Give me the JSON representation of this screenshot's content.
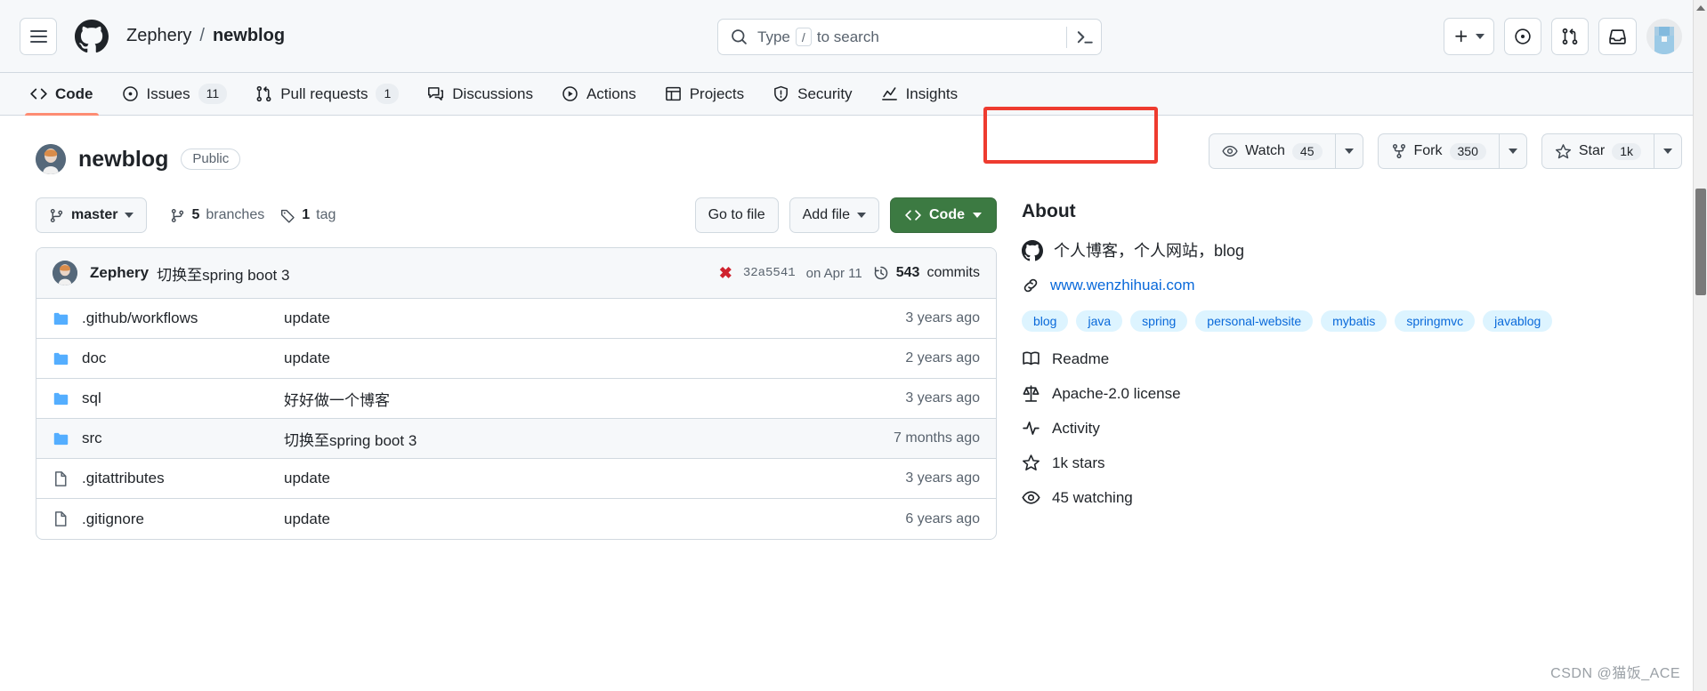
{
  "header": {
    "menu_label": "menu",
    "breadcrumb": {
      "owner": "Zephery",
      "separator": "/",
      "repo": "newblog"
    },
    "search": {
      "placeholder_prefix": "Type",
      "slash_key": "/",
      "placeholder_suffix": "to search"
    },
    "top_buttons": [
      "create-new",
      "issues-feed",
      "pull-requests",
      "inbox",
      "profile"
    ]
  },
  "nav": {
    "tabs": [
      {
        "label": "Code",
        "icon": "code-icon",
        "count": "",
        "active": true
      },
      {
        "label": "Issues",
        "icon": "issue-icon",
        "count": "11",
        "active": false
      },
      {
        "label": "Pull requests",
        "icon": "pull-request-icon",
        "count": "1",
        "active": false
      },
      {
        "label": "Discussions",
        "icon": "discussion-icon",
        "count": "",
        "active": false
      },
      {
        "label": "Actions",
        "icon": "play-icon",
        "count": "",
        "active": false
      },
      {
        "label": "Projects",
        "icon": "table-icon",
        "count": "",
        "active": false
      },
      {
        "label": "Security",
        "icon": "shield-icon",
        "count": "",
        "active": false
      },
      {
        "label": "Insights",
        "icon": "graph-icon",
        "count": "",
        "active": false
      }
    ]
  },
  "repo": {
    "name": "newblog",
    "visibility": "Public",
    "watch": {
      "label": "Watch",
      "count": "45"
    },
    "fork": {
      "label": "Fork",
      "count": "350"
    },
    "star": {
      "label": "Star",
      "count": "1k"
    }
  },
  "filebar": {
    "branch": "master",
    "branches_count": "5",
    "branches_label": "branches",
    "tags_count": "1",
    "tags_label": "tag",
    "go_to_file": "Go to file",
    "add_file": "Add file",
    "code": "Code"
  },
  "commit": {
    "author": "Zephery",
    "message": "切换至spring boot 3",
    "status": "failed",
    "sha": "32a5541",
    "date": "on Apr 11",
    "commits_count": "543",
    "commits_label": "commits"
  },
  "files": [
    {
      "name": ".github/workflows",
      "type": "folder",
      "message": "update",
      "time": "3 years ago"
    },
    {
      "name": "doc",
      "type": "folder",
      "message": "update",
      "time": "2 years ago"
    },
    {
      "name": "sql",
      "type": "folder",
      "message": "好好做一个博客",
      "time": "3 years ago"
    },
    {
      "name": "src",
      "type": "folder",
      "message": "切换至spring boot 3",
      "time": "7 months ago"
    },
    {
      "name": ".gitattributes",
      "type": "file",
      "message": "update",
      "time": "3 years ago"
    },
    {
      "name": ".gitignore",
      "type": "file",
      "message": "update",
      "time": "6 years ago"
    }
  ],
  "about": {
    "title": "About",
    "description": "个人博客，个人网站，blog",
    "website": "www.wenzhihuai.com",
    "topics": [
      "blog",
      "java",
      "spring",
      "personal-website",
      "mybatis",
      "springmvc",
      "javablog"
    ],
    "links": [
      {
        "label": "Readme",
        "icon": "book-icon"
      },
      {
        "label": "Apache-2.0 license",
        "icon": "law-icon"
      },
      {
        "label": "Activity",
        "icon": "pulse-icon"
      },
      {
        "label": "1k stars",
        "icon": "star-icon"
      },
      {
        "label": "45 watching",
        "icon": "eye-icon"
      }
    ]
  },
  "watermark": "CSDN @猫饭_ACE",
  "colors": {
    "accent_green": "#3c7a42",
    "link_blue": "#0969da",
    "highlight_red": "#ee3b2f",
    "active_tab_orange": "#fd8c73"
  }
}
